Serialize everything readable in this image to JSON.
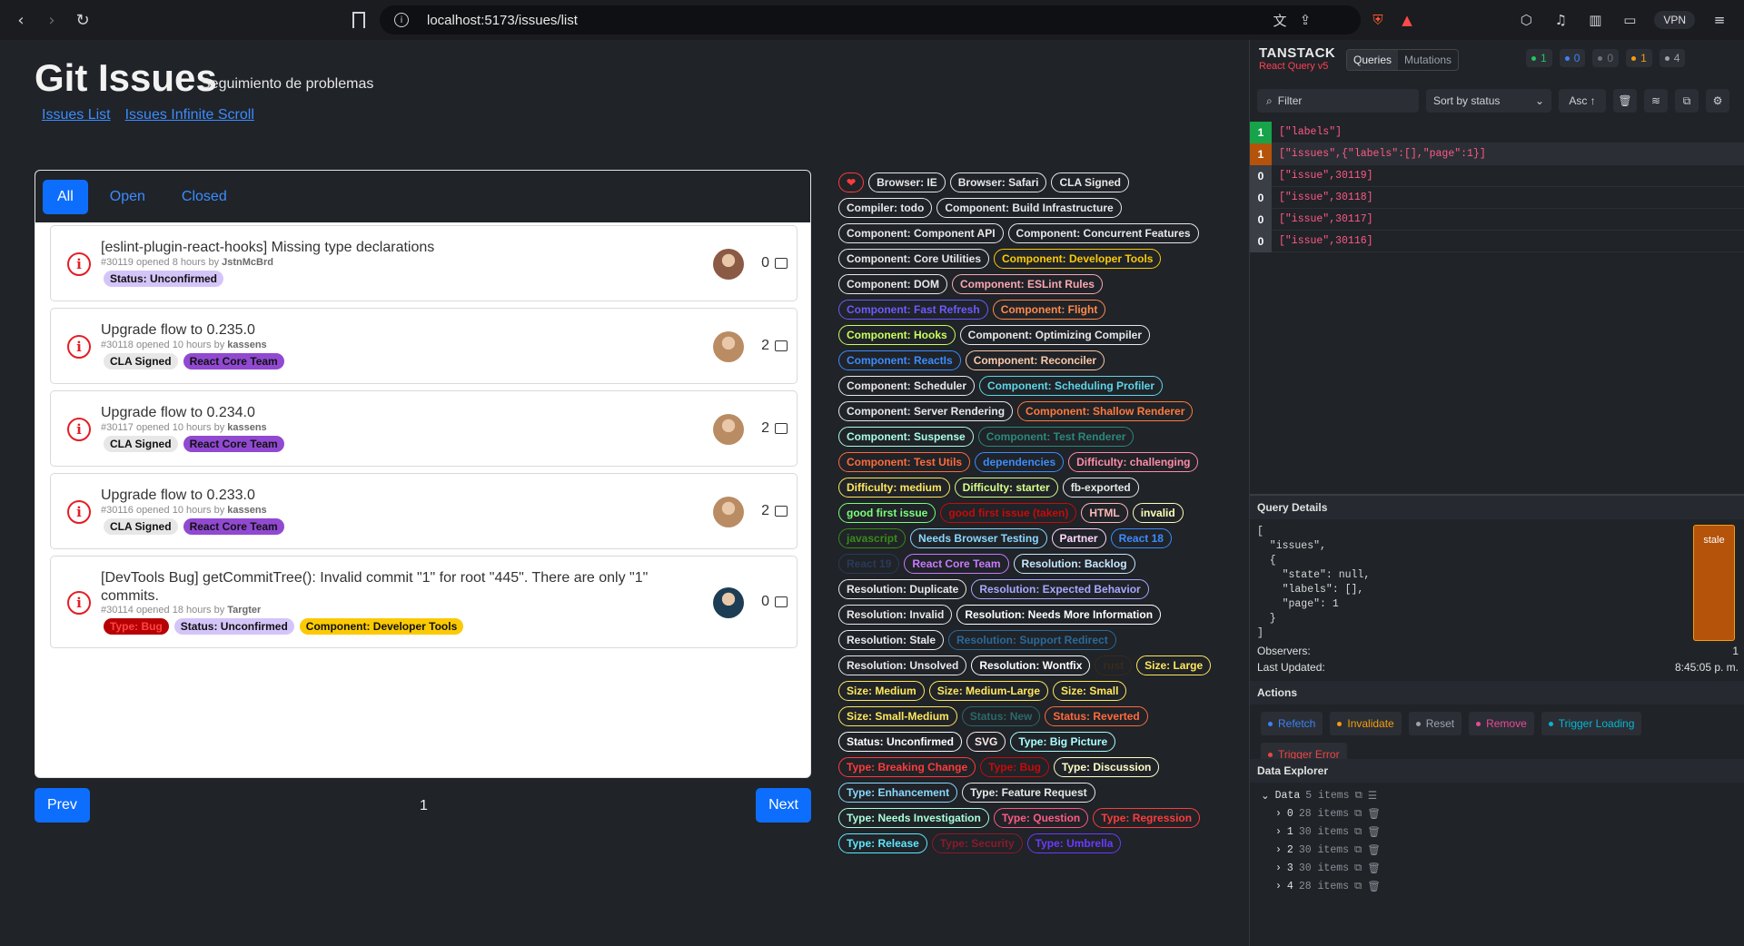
{
  "browser": {
    "url": "localhost:5173/issues/list",
    "vpn_label": "VPN"
  },
  "header": {
    "title": "Git Issues",
    "subtitle": "Seguimiento de problemas",
    "links": [
      "Issues List",
      "Issues Infinite Scroll"
    ]
  },
  "tabs": [
    "All",
    "Open",
    "Closed"
  ],
  "issues": [
    {
      "title": "[eslint-plugin-react-hooks] Missing type declarations",
      "meta_prefix": "#30119 opened 8 hours by",
      "author": "JstnMcBrd",
      "comments": "0",
      "labels": [
        {
          "text": "Status: Unconfirmed",
          "bg": "#d4c5f9"
        }
      ],
      "avatar_color": "#8a5a44"
    },
    {
      "title": "Upgrade flow to 0.235.0",
      "meta_prefix": "#30118 opened 10 hours by",
      "author": "kassens",
      "comments": "2",
      "labels": [
        {
          "text": "CLA Signed",
          "bg": "#e7e7e7"
        },
        {
          "text": "React Core Team",
          "bg": "#9149d1"
        }
      ],
      "avatar_color": "#b98c63"
    },
    {
      "title": "Upgrade flow to 0.234.0",
      "meta_prefix": "#30117 opened 10 hours by",
      "author": "kassens",
      "comments": "2",
      "labels": [
        {
          "text": "CLA Signed",
          "bg": "#e7e7e7"
        },
        {
          "text": "React Core Team",
          "bg": "#9149d1"
        }
      ],
      "avatar_color": "#b98c63"
    },
    {
      "title": "Upgrade flow to 0.233.0",
      "meta_prefix": "#30116 opened 10 hours by",
      "author": "kassens",
      "comments": "2",
      "labels": [
        {
          "text": "CLA Signed",
          "bg": "#e7e7e7"
        },
        {
          "text": "React Core Team",
          "bg": "#9149d1"
        }
      ],
      "avatar_color": "#b98c63"
    },
    {
      "title": "[DevTools Bug] getCommitTree(): Invalid commit \"1\" for root \"445\". There are only \"1\"",
      "title2": "commits.",
      "meta_prefix": "#30114 opened 18 hours by",
      "author": "Targter",
      "comments": "0",
      "labels": [
        {
          "text": "Type: Bug",
          "bg": "#b60205",
          "fg": "#ff4444"
        },
        {
          "text": "Status: Unconfirmed",
          "bg": "#d4c5f9"
        },
        {
          "text": "Component: Developer Tools",
          "bg": "#fbca04"
        }
      ],
      "avatar_color": "#1d3d55"
    }
  ],
  "pager": {
    "prev": "Prev",
    "page": "1",
    "next": "Next"
  },
  "label_cloud": [
    {
      "t": "❤",
      "c": "#ff3b3b"
    },
    {
      "t": "Browser: IE",
      "c": "#e8e8e8"
    },
    {
      "t": "Browser: Safari",
      "c": "#e8e8e8"
    },
    {
      "t": "CLA Signed",
      "c": "#e8e8e8"
    },
    {
      "t": "Compiler: todo",
      "c": "#e8e8e8"
    },
    {
      "t": "Component: Build Infrastructure",
      "c": "#e8e8e8"
    },
    {
      "t": "Component: Component API",
      "c": "#e8e8e8"
    },
    {
      "t": "Component: Concurrent Features",
      "c": "#e8e8e8"
    },
    {
      "t": "Component: Core Utilities",
      "c": "#e8e8e8"
    },
    {
      "t": "Component: Developer Tools",
      "c": "#fbca04"
    },
    {
      "t": "Component: DOM",
      "c": "#e8e8e8"
    },
    {
      "t": "Component: ESLint Rules",
      "c": "#f9a8b0"
    },
    {
      "t": "Component: Fast Refresh",
      "c": "#6b5bff"
    },
    {
      "t": "Component: Flight",
      "c": "#ff8a4c"
    },
    {
      "t": "Component: Hooks",
      "c": "#c8ff5c"
    },
    {
      "t": "Component: Optimizing Compiler",
      "c": "#e8e8e8"
    },
    {
      "t": "Component: ReactIs",
      "c": "#3b8cff"
    },
    {
      "t": "Component: Reconciler",
      "c": "#f9c8a8"
    },
    {
      "t": "Component: Scheduler",
      "c": "#e8e8e8"
    },
    {
      "t": "Component: Scheduling Profiler",
      "c": "#5cd6e8"
    },
    {
      "t": "Component: Server Rendering",
      "c": "#e8e8e8"
    },
    {
      "t": "Component: Shallow Renderer",
      "c": "#ff7a3b"
    },
    {
      "t": "Component: Suspense",
      "c": "#a8ffe8"
    },
    {
      "t": "Component: Test Renderer",
      "c": "#2a8a7a"
    },
    {
      "t": "Component: Test Utils",
      "c": "#ff6a3b"
    },
    {
      "t": "dependencies",
      "c": "#3b8cff"
    },
    {
      "t": "Difficulty: challenging",
      "c": "#ff8aa8"
    },
    {
      "t": "Difficulty: medium",
      "c": "#ffe85c"
    },
    {
      "t": "Difficulty: starter",
      "c": "#d8ff8a"
    },
    {
      "t": "fb-exported",
      "c": "#e8e8e8"
    },
    {
      "t": "good first issue",
      "c": "#7aff7a"
    },
    {
      "t": "good first issue (taken)",
      "c": "#c80a0a"
    },
    {
      "t": "HTML",
      "c": "#ffb8b8"
    },
    {
      "t": "invalid",
      "c": "#ffffb8"
    },
    {
      "t": "javascript",
      "c": "#3a8a1a"
    },
    {
      "t": "Needs Browser Testing",
      "c": "#8ad8ff"
    },
    {
      "t": "Partner",
      "c": "#ffd8ff"
    },
    {
      "t": "React 18",
      "c": "#3b8cff"
    },
    {
      "t": "React 19",
      "c": "#2a3a5a"
    },
    {
      "t": "React Core Team",
      "c": "#c87aff"
    },
    {
      "t": "Resolution: Backlog",
      "c": "#c8e8ff"
    },
    {
      "t": "Resolution: Duplicate",
      "c": "#e8e8e8"
    },
    {
      "t": "Resolution: Expected Behavior",
      "c": "#a8a8ff"
    },
    {
      "t": "Resolution: Invalid",
      "c": "#e8e8e8"
    },
    {
      "t": "Resolution: Needs More Information",
      "c": "#ffffff"
    },
    {
      "t": "Resolution: Stale",
      "c": "#e8e8e8"
    },
    {
      "t": "Resolution: Support Redirect",
      "c": "#2a6a9a"
    },
    {
      "t": "Resolution: Unsolved",
      "c": "#e8e8e8"
    },
    {
      "t": "Resolution: Wontfix",
      "c": "#ffffff"
    },
    {
      "t": "rust",
      "c": "#3a2a1a"
    },
    {
      "t": "Size: Large",
      "c": "#ffe85c"
    },
    {
      "t": "Size: Medium",
      "c": "#ffe85c"
    },
    {
      "t": "Size: Medium-Large",
      "c": "#ffe85c"
    },
    {
      "t": "Size: Small",
      "c": "#ffe85c"
    },
    {
      "t": "Size: Small-Medium",
      "c": "#ffe85c"
    },
    {
      "t": "Status: New",
      "c": "#2a6a6a"
    },
    {
      "t": "Status: Reverted",
      "c": "#ff6a3b"
    },
    {
      "t": "Status: Unconfirmed",
      "c": "#ffffff"
    },
    {
      "t": "SVG",
      "c": "#ffe8e8"
    },
    {
      "t": "Type: Big Picture",
      "c": "#a8ffff"
    },
    {
      "t": "Type: Breaking Change",
      "c": "#ff3b3b"
    },
    {
      "t": "Type: Bug",
      "c": "#c80a0a"
    },
    {
      "t": "Type: Discussion",
      "c": "#ffffc8"
    },
    {
      "t": "Type: Enhancement",
      "c": "#8ad8ff"
    },
    {
      "t": "Type: Feature Request",
      "c": "#e8e8e8"
    },
    {
      "t": "Type: Needs Investigation",
      "c": "#a8ffd8"
    },
    {
      "t": "Type: Question",
      "c": "#ff5a85"
    },
    {
      "t": "Type: Regression",
      "c": "#ff3b3b"
    },
    {
      "t": "Type: Release",
      "c": "#5ce8ff"
    },
    {
      "t": "Type: Security",
      "c": "#8a1a2a"
    },
    {
      "t": "Type: Umbrella",
      "c": "#6a3bff"
    }
  ],
  "devtools": {
    "brand": "TANSTACK",
    "brand_sub": "React Query v5",
    "tabs": [
      "Queries",
      "Mutations"
    ],
    "counts": [
      {
        "n": "1",
        "color": "#22c55e"
      },
      {
        "n": "0",
        "color": "#3b82f6"
      },
      {
        "n": "0",
        "color": "#6b7280"
      },
      {
        "n": "1",
        "color": "#f59e0b"
      },
      {
        "n": "4",
        "color": "#9ca3af"
      }
    ],
    "filter_placeholder": "Filter",
    "sort_label": "Sort by status",
    "asc_label": "Asc ↑",
    "queries": [
      {
        "n": "1",
        "key": "[\"labels\"]",
        "color": "#16a34a"
      },
      {
        "n": "1",
        "key": "[\"issues\",{\"labels\":[],\"page\":1}]",
        "color": "#b45309"
      },
      {
        "n": "0",
        "key": "[\"issue\",30119]",
        "color": "#3a3e45"
      },
      {
        "n": "0",
        "key": "[\"issue\",30118]",
        "color": "#3a3e45"
      },
      {
        "n": "0",
        "key": "[\"issue\",30117]",
        "color": "#3a3e45"
      },
      {
        "n": "0",
        "key": "[\"issue\",30116]",
        "color": "#3a3e45"
      }
    ],
    "details_title": "Query Details",
    "query_json": "[\n  \"issues\",\n  {\n    \"state\": null,\n    \"labels\": [],\n    \"page\": 1\n  }\n]",
    "status": "stale",
    "observers_label": "Observers:",
    "observers": "1",
    "updated_label": "Last Updated:",
    "updated": "8:45:05 p. m.",
    "actions_title": "Actions",
    "actions": [
      {
        "t": "Refetch",
        "c": "#3b82f6"
      },
      {
        "t": "Invalidate",
        "c": "#f59e0b"
      },
      {
        "t": "Reset",
        "c": "#9ca3af"
      },
      {
        "t": "Remove",
        "c": "#ec4899"
      },
      {
        "t": "Trigger Loading",
        "c": "#06b6d4"
      },
      {
        "t": "Trigger Error",
        "c": "#ef4444"
      }
    ],
    "explorer_title": "Data Explorer",
    "data_root": "Data",
    "data_root_count": "5 items",
    "data_items": [
      {
        "i": "0",
        "c": "28 items"
      },
      {
        "i": "1",
        "c": "30 items"
      },
      {
        "i": "2",
        "c": "30 items"
      },
      {
        "i": "3",
        "c": "30 items"
      },
      {
        "i": "4",
        "c": "28 items"
      }
    ]
  }
}
